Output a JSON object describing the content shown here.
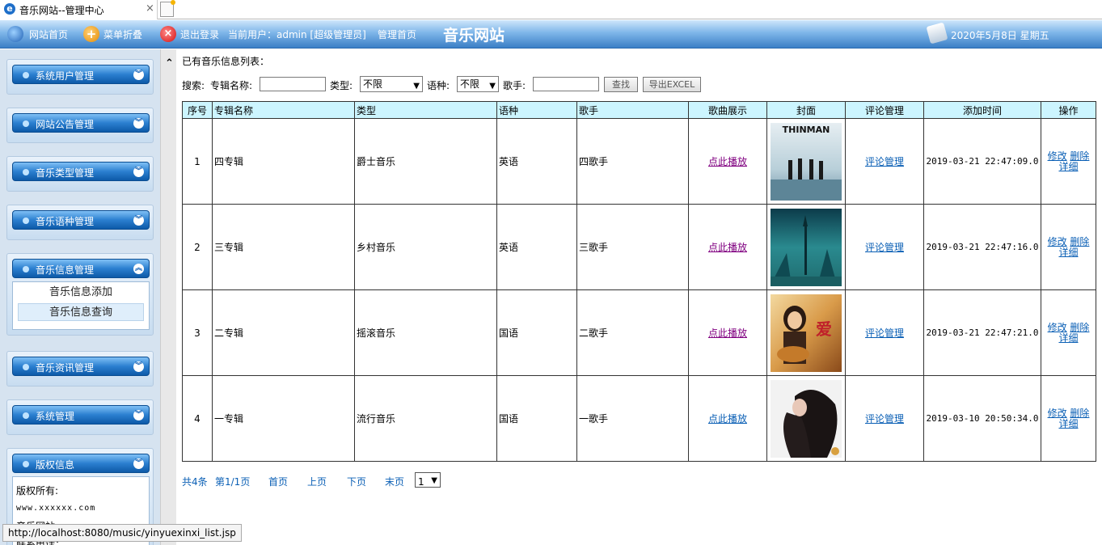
{
  "browser": {
    "tab_title": "音乐网站--管理中心",
    "tab_close": "×",
    "status_url": "http://localhost:8080/music/yinyuexinxi_list.jsp"
  },
  "header": {
    "home": "网站首页",
    "menu_toggle": "菜单折叠",
    "logout": "退出登录",
    "current_user": "当前用户：admin [超级管理员]",
    "admin_home": "管理首页",
    "site_title": "音乐网站",
    "date": "2020年5月8日 星期五"
  },
  "sidebar": {
    "groups": [
      {
        "label": "系统用户管理"
      },
      {
        "label": "网站公告管理"
      },
      {
        "label": "音乐类型管理"
      },
      {
        "label": "音乐语种管理"
      },
      {
        "label": "音乐信息管理",
        "items": [
          "音乐信息添加",
          "音乐信息查询"
        ]
      },
      {
        "label": "音乐资讯管理"
      },
      {
        "label": "系统管理"
      },
      {
        "label": "版权信息",
        "lines": [
          "版权所有:",
          "www.xxxxxx.com",
          "音乐网站",
          "联系电话："
        ]
      }
    ]
  },
  "main": {
    "list_title": "已有音乐信息列表：",
    "search": {
      "label": "搜索:",
      "album_label": "专辑名称:",
      "type_label": "类型:",
      "type_value": "不限",
      "lang_label": "语种:",
      "lang_value": "不限",
      "singer_label": "歌手:",
      "search_btn": "查找",
      "export_btn": "导出EXCEL"
    },
    "table": {
      "headers": [
        "序号",
        "专辑名称",
        "类型",
        "语种",
        "歌手",
        "歌曲展示",
        "封面",
        "评论管理",
        "添加时间",
        "操作"
      ],
      "rows": [
        {
          "no": "1",
          "album": "四专辑",
          "type": "爵士音乐",
          "lang": "英语",
          "singer": "四歌手",
          "play": "点此播放",
          "comment": "评论管理",
          "time": "2019-03-21 22:47:09.0",
          "edit": "修改",
          "del": "删除",
          "detail": "详细"
        },
        {
          "no": "2",
          "album": "三专辑",
          "type": "乡村音乐",
          "lang": "英语",
          "singer": "三歌手",
          "play": "点此播放",
          "comment": "评论管理",
          "time": "2019-03-21 22:47:16.0",
          "edit": "修改",
          "del": "删除",
          "detail": "详细"
        },
        {
          "no": "3",
          "album": "二专辑",
          "type": "摇滚音乐",
          "lang": "国语",
          "singer": "二歌手",
          "play": "点此播放",
          "comment": "评论管理",
          "time": "2019-03-21 22:47:21.0",
          "edit": "修改",
          "del": "删除",
          "detail": "详细"
        },
        {
          "no": "4",
          "album": "一专辑",
          "type": "流行音乐",
          "lang": "国语",
          "singer": "一歌手",
          "play": "点此播放",
          "comment": "评论管理",
          "time": "2019-03-10 20:50:34.0",
          "edit": "修改",
          "del": "删除",
          "detail": "详细"
        }
      ]
    },
    "cover_text": {
      "thinman": "THINMAN",
      "love": "爱"
    },
    "pager": {
      "total": "共4条",
      "page": "第1/1页",
      "first": "首页",
      "prev": "上页",
      "next": "下页",
      "last": "末页",
      "select": "1"
    }
  }
}
